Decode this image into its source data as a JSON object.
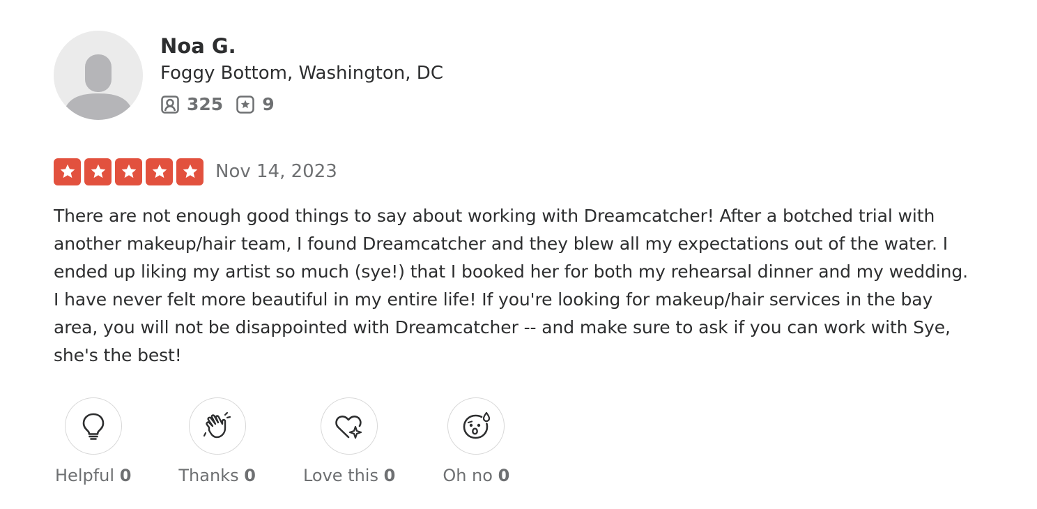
{
  "user": {
    "name": "Noa G.",
    "location": "Foggy Bottom, Washington, DC",
    "friends_count": "325",
    "reviews_count": "9"
  },
  "review": {
    "rating": 5,
    "rating_max": 5,
    "star_color": "#e2513e",
    "date": "Nov 14, 2023",
    "text": "There are not enough good things to say about working with Dreamcatcher! After a botched trial with another makeup/hair team, I found Dreamcatcher and they blew all my expectations out of the water. I ended up liking my artist so much (sye!) that I booked her for both my rehearsal dinner and my wedding. I have never felt more beautiful in my entire life! If you're looking for makeup/hair services in the bay area, you will not be disappointed with Dreamcatcher -- and make sure to ask if you can work with Sye, she's the best!"
  },
  "reactions": [
    {
      "label": "Helpful",
      "count": "0",
      "icon": "lightbulb-icon"
    },
    {
      "label": "Thanks",
      "count": "0",
      "icon": "waving-hand-icon"
    },
    {
      "label": "Love this",
      "count": "0",
      "icon": "heart-sparkle-icon"
    },
    {
      "label": "Oh no",
      "count": "0",
      "icon": "surprised-face-icon"
    }
  ]
}
